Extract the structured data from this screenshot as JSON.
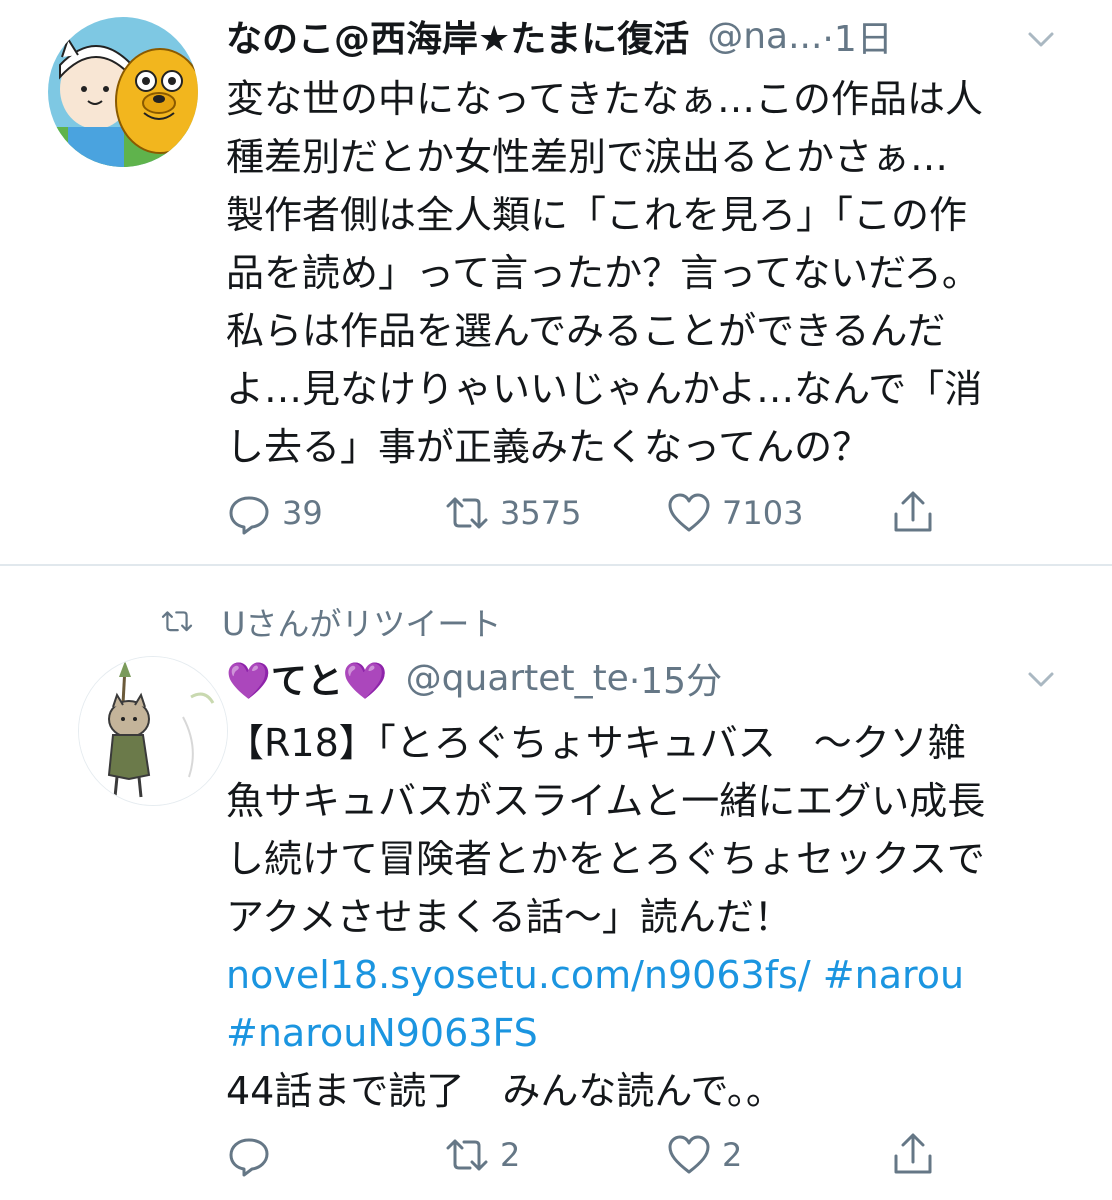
{
  "tweets": [
    {
      "display_name": "なのこ@西海岸★たまに復活",
      "handle": "@na...",
      "time": "·1日",
      "text": "変な世の中になってきたなぁ…この作品は人\n種差別だとか女性差別で涙出るとかさぁ…\n製作者側は全人類に「これを見ろ」「この作\n品を読め」って言ったか？言ってないだろ。\n私らは作品を選んでみることができるんだ\nよ…見なけりゃいいじゃんかよ…なんで「消\nし去る」事が正義みたくなってんの？",
      "reply_count": "39",
      "retweet_count": "3575",
      "like_count": "7103"
    },
    {
      "retweet_context": "Uさんがリツイート",
      "display_name": "💜てと💜",
      "handle": "@quartet_te",
      "time": "·15分",
      "text_main": "【R18】「とろぐちょサキュバス　～クソ雑\n魚サキュバスがスライムと一緒にエグい成長\nし続けて冒険者とかをとろぐちょセックスで\nアクメさせまくる話～」読んだ！\n",
      "link_url": "novel18.syosetu.com/n9063fs/",
      "hashtag1": "#narou",
      "hashtag2": "#narouN9063FS",
      "text_tail": "44話まで読了　みんな読んで。。",
      "reply_count": "",
      "retweet_count": "2",
      "like_count": "2"
    }
  ],
  "icons": {
    "reply": "reply-icon",
    "retweet": "retweet-icon",
    "like": "heart-icon",
    "share": "share-icon",
    "caret": "chevron-down-icon"
  },
  "colors": {
    "text": "#14171a",
    "secondary": "#657786",
    "link": "#1b95e0",
    "divider": "#e1e8ed"
  }
}
